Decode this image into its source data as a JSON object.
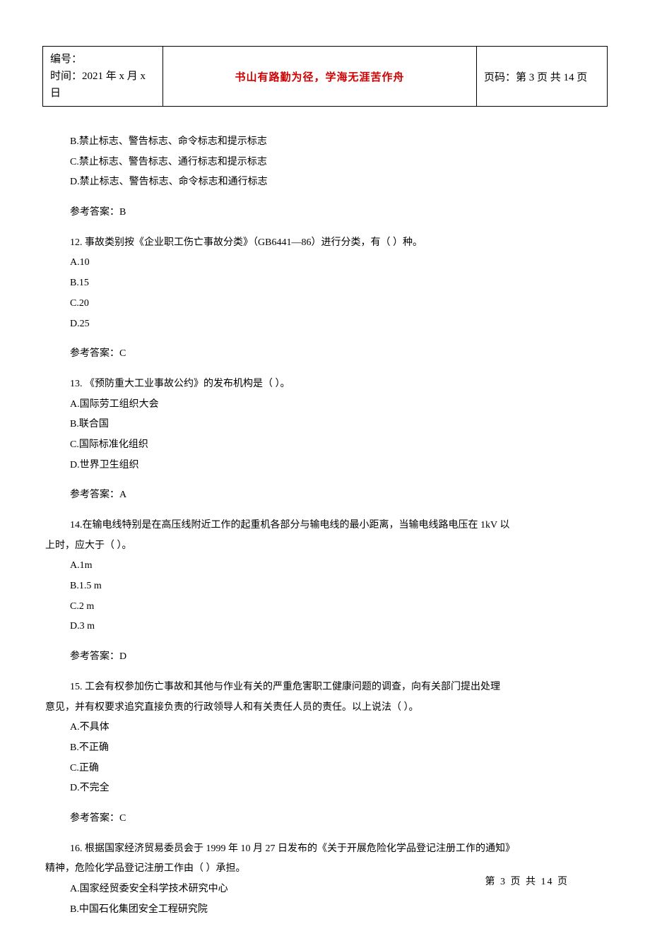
{
  "header": {
    "left_line1": "编号：",
    "left_line2": "时间：2021 年 x 月 x 日",
    "center": "书山有路勤为径，学海无涯苦作舟",
    "right": "页码：第 3 页  共 14 页"
  },
  "leadin": {
    "optB": "B.禁止标志、警告标志、命令标志和提示标志",
    "optC": "C.禁止标志、警告标志、通行标志和提示标志",
    "optD": "D.禁止标志、警告标志、命令标志和通行标志",
    "answer": "参考答案：B"
  },
  "q12": {
    "stem": "12. 事故类别按《企业职工伤亡事故分类》（GB6441—86）进行分类，有（  ）种。",
    "optA": "A.10",
    "optB": "B.15",
    "optC": "C.20",
    "optD": "D.25",
    "answer": "参考答案：C"
  },
  "q13": {
    "stem": "13. 《预防重大工业事故公约》的发布机构是（  ）。",
    "optA": "A.国际劳工组织大会",
    "optB": "B.联合国",
    "optC": "C.国际标准化组织",
    "optD": "D.世界卫生组织",
    "answer": "参考答案：A"
  },
  "q14": {
    "stem1": "14.在输电线特别是在高压线附近工作的起重机各部分与输电线的最小距离，当输电线路电压在 1kV 以",
    "stem2": "上时，应大于（  ）。",
    "optA": "A.1m",
    "optB": "B.1.5 m",
    "optC": "C.2 m",
    "optD": "D.3 m",
    "answer": "参考答案：D"
  },
  "q15": {
    "stem1": "15. 工会有权参加伤亡事故和其他与作业有关的严重危害职工健康问题的调查，向有关部门提出处理",
    "stem2": "意见，并有权要求追究直接负责的行政领导人和有关责任人员的责任。以上说法（  ）。",
    "optA": "A.不具体",
    "optB": "B.不正确",
    "optC": "C.正确",
    "optD": "D.不完全",
    "answer": "参考答案：C"
  },
  "q16": {
    "stem1": "16. 根据国家经济贸易委员会于 1999 年 10 月 27 日发布的《关于开展危险化学品登记注册工作的通知》",
    "stem2": "精神，危险化学品登记注册工作由（  ）承担。",
    "optA": "A.国家经贸委安全科学技术研究中心",
    "optB": "B.中国石化集团安全工程研究院"
  },
  "footer": "第 3 页 共 14 页"
}
